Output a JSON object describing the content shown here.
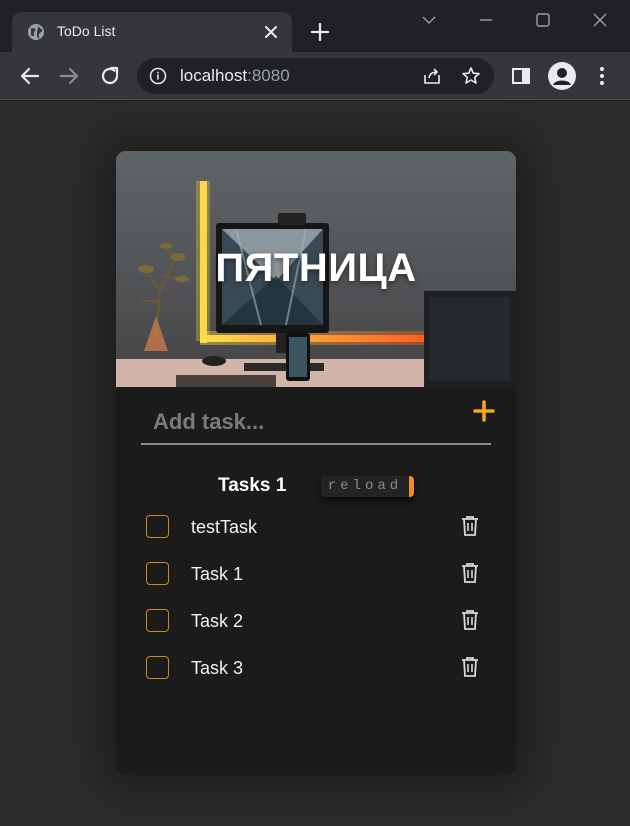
{
  "browser": {
    "tab_title": "ToDo List",
    "url_host": "localhost",
    "url_port": ":8080"
  },
  "app": {
    "hero_title": "ПЯТНИЦА",
    "add_placeholder": "Add task...",
    "tasks_header": "Tasks 1",
    "reload_label": "reload",
    "accent_color": "#f5a623",
    "tasks": [
      {
        "label": "testTask",
        "checked": false
      },
      {
        "label": "Task 1",
        "checked": false
      },
      {
        "label": "Task 2",
        "checked": false
      },
      {
        "label": "Task 3",
        "checked": false
      }
    ]
  }
}
